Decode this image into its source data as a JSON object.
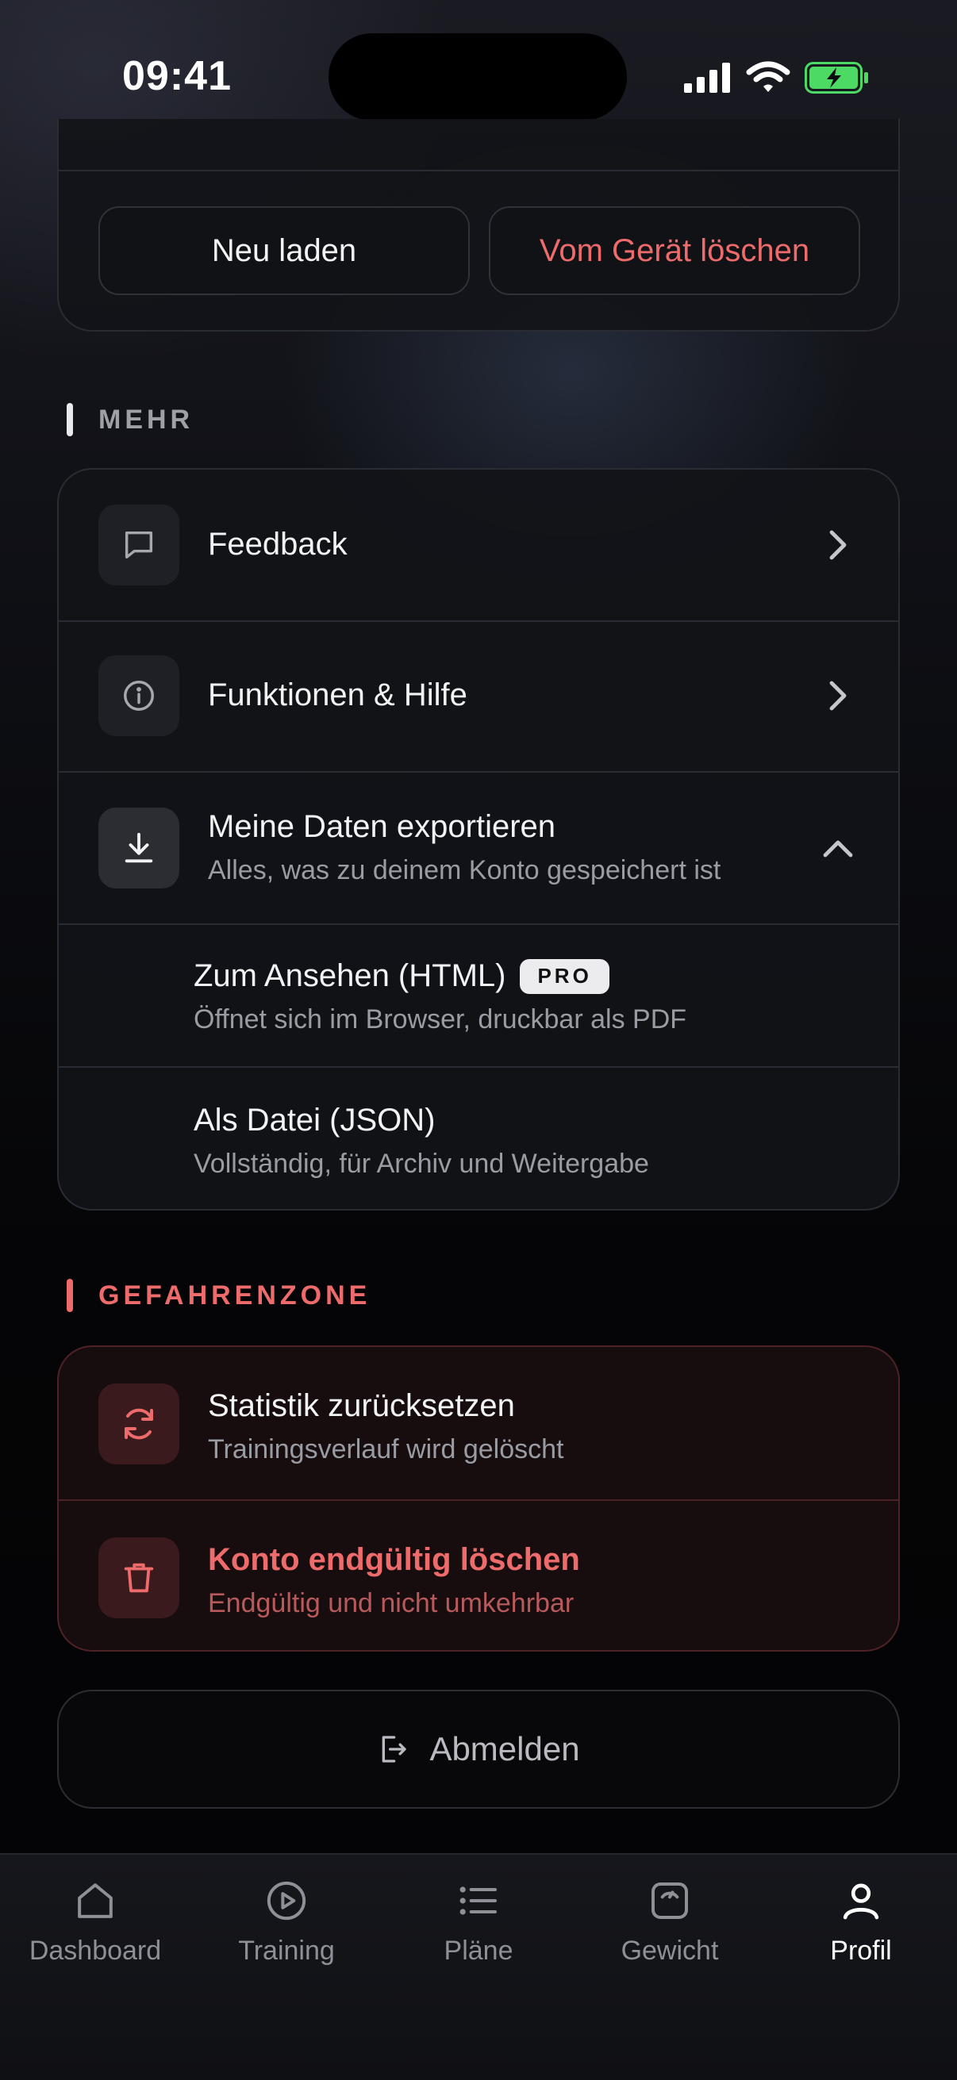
{
  "status_bar": {
    "time": "09:41"
  },
  "top_card": {
    "reload_label": "Neu laden",
    "delete_device_label": "Vom Gerät löschen"
  },
  "more": {
    "section_title": "MEHR",
    "feedback": {
      "title": "Feedback",
      "icon": "message-square-icon"
    },
    "help": {
      "title": "Funktionen & Hilfe",
      "icon": "info-circle-icon"
    },
    "export": {
      "title": "Meine Daten exportieren",
      "subtitle": "Alles, was zu deinem Konto gespeichert ist",
      "icon": "download-icon",
      "expanded": true,
      "options": [
        {
          "title": "Zum Ansehen (HTML)",
          "badge": "PRO",
          "subtitle": "Öffnet sich im Browser, druckbar als PDF"
        },
        {
          "title": "Als Datei (JSON)",
          "subtitle": "Vollständig, für Archiv und Weitergabe"
        }
      ]
    }
  },
  "danger_zone": {
    "section_title": "GEFAHRENZONE",
    "reset": {
      "title": "Statistik zurücksetzen",
      "subtitle": "Trainingsverlauf wird gelöscht",
      "icon": "refresh-icon"
    },
    "delete_account": {
      "title": "Konto endgültig löschen",
      "subtitle": "Endgültig und nicht umkehrbar",
      "icon": "trash-icon"
    }
  },
  "logout": {
    "label": "Abmelden",
    "icon": "logout-icon"
  },
  "tabs": [
    {
      "label": "Dashboard",
      "icon": "home-icon",
      "active": false
    },
    {
      "label": "Training",
      "icon": "play-circle-icon",
      "active": false
    },
    {
      "label": "Pläne",
      "icon": "list-icon",
      "active": false
    },
    {
      "label": "Gewicht",
      "icon": "scale-icon",
      "active": false
    },
    {
      "label": "Profil",
      "icon": "user-icon",
      "active": true
    }
  ],
  "colors": {
    "danger": "#ee6b6b",
    "accent_white": "#ffffff",
    "muted": "#9a9ca3",
    "battery_green": "#4cd964"
  }
}
